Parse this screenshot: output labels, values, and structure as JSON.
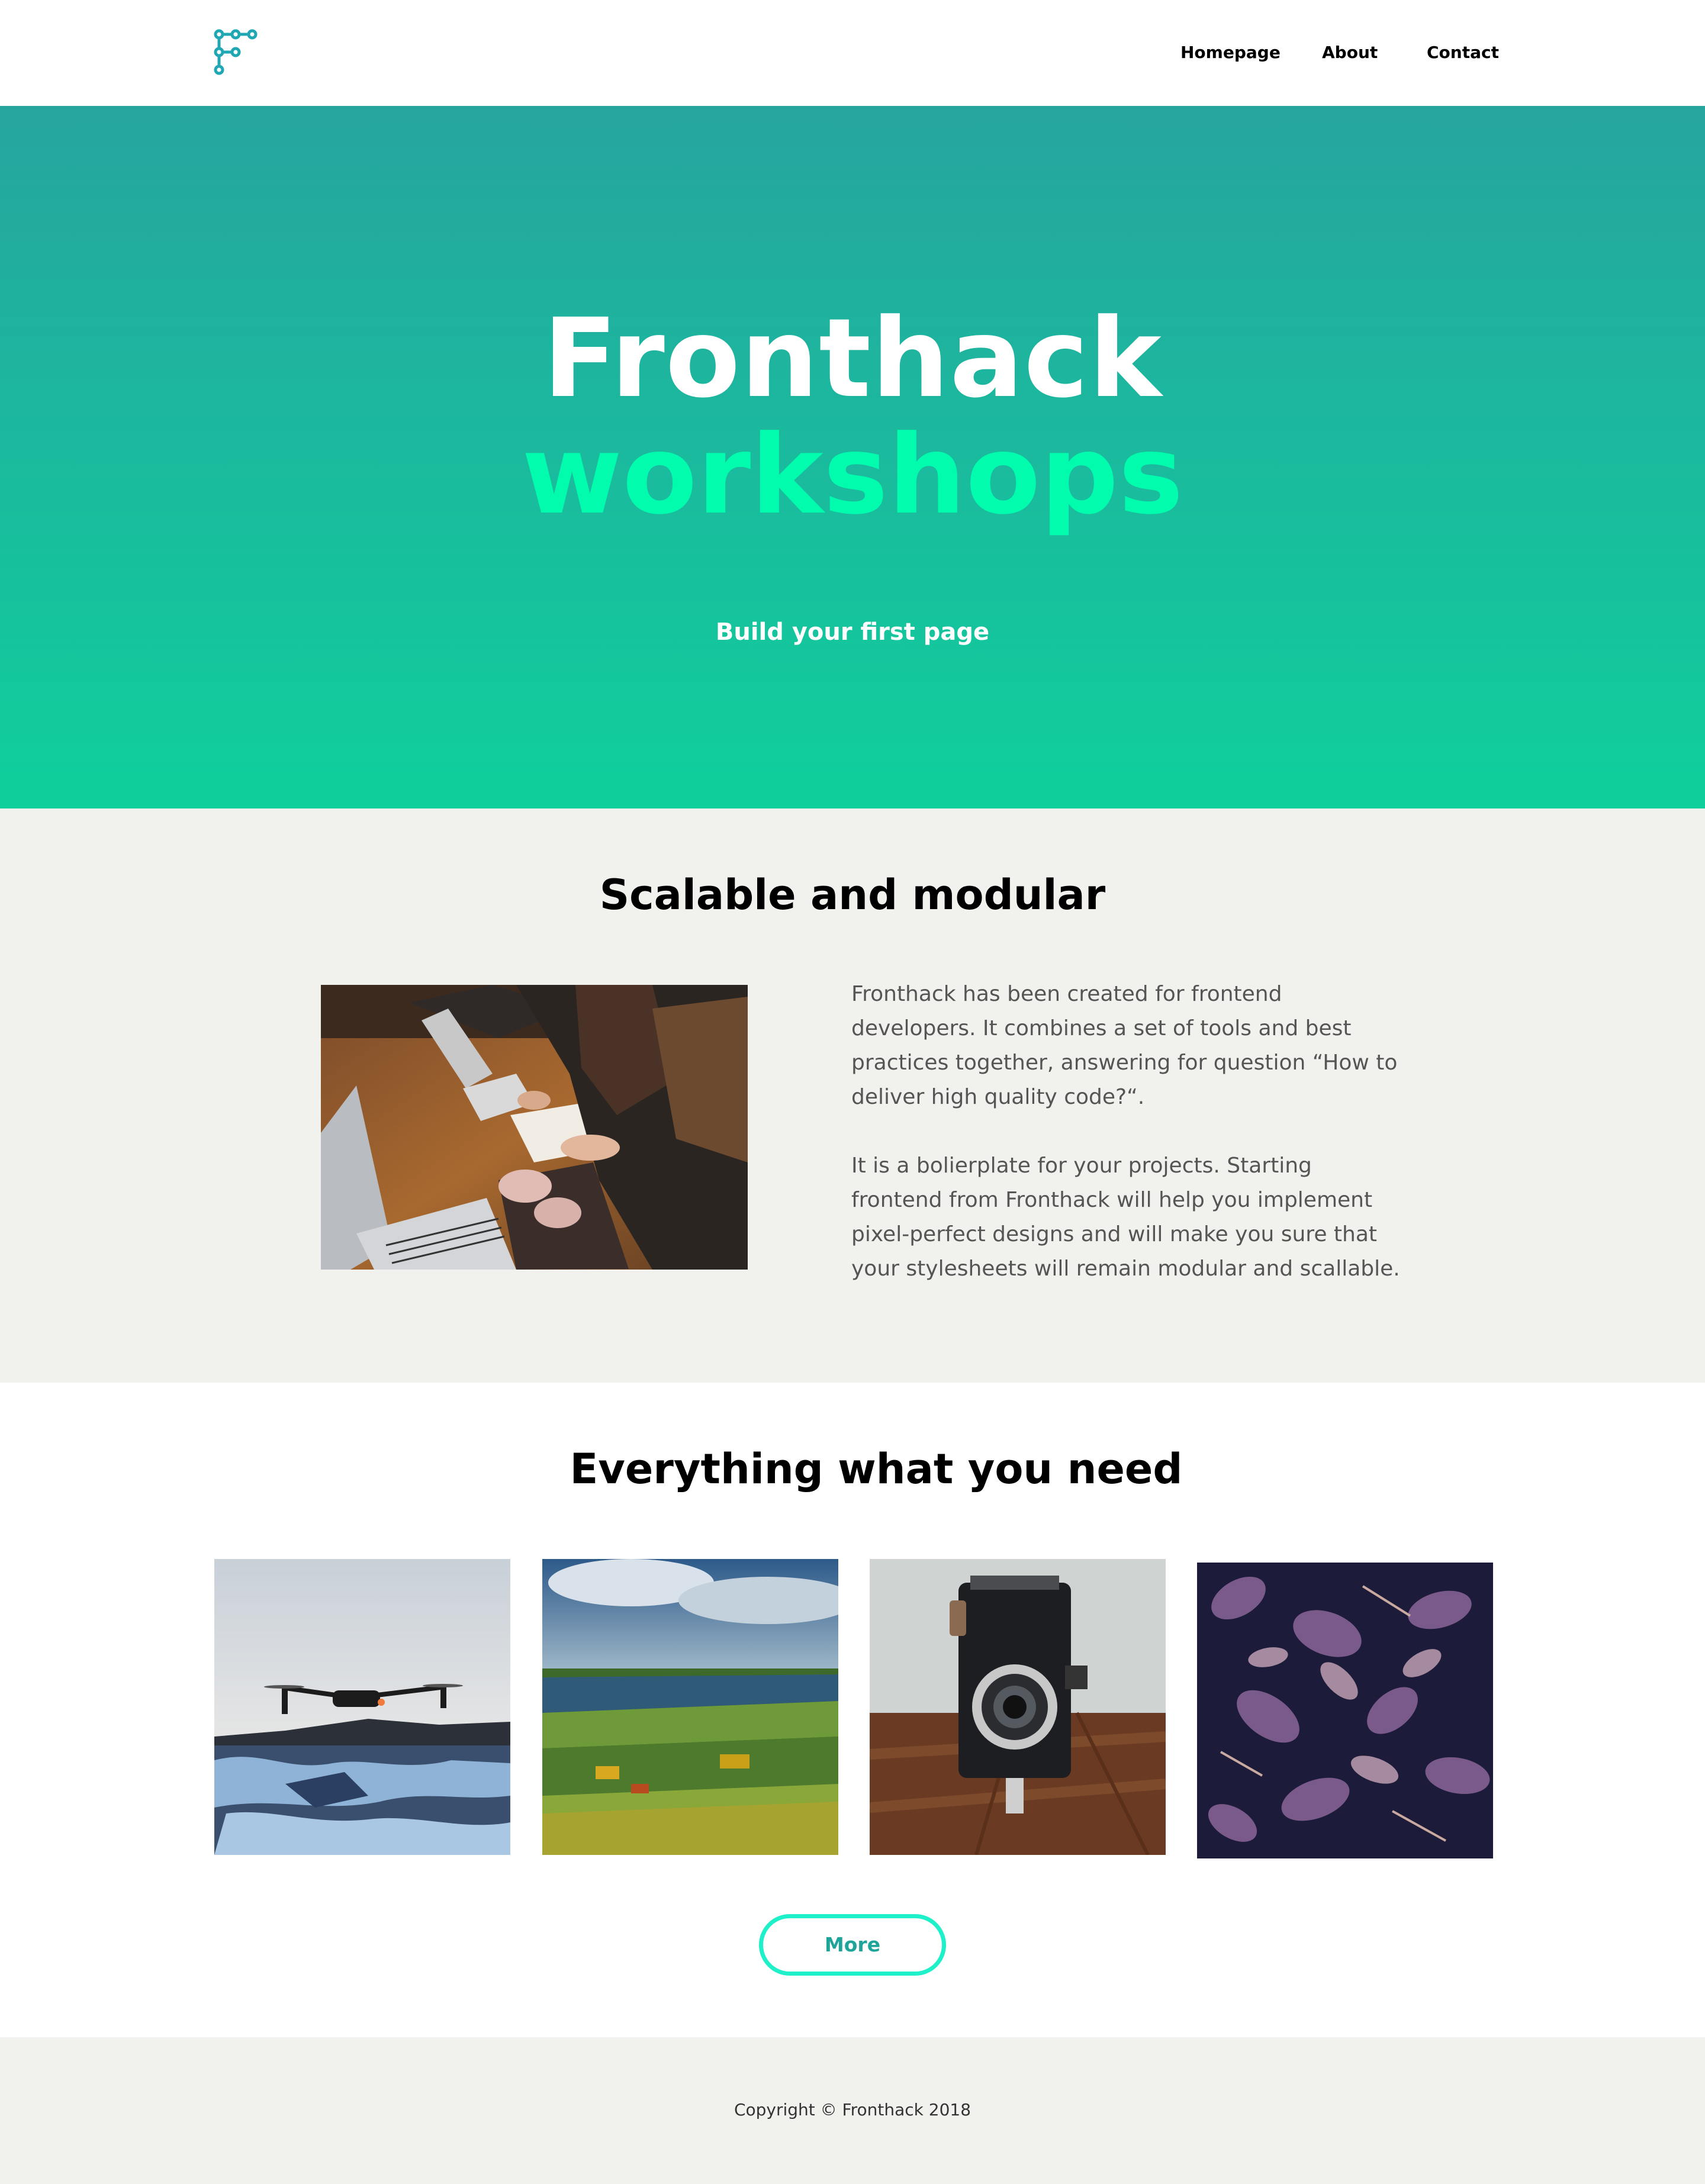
{
  "header": {
    "logo_icon": "fronthack-f-dots-logo-icon",
    "nav": [
      {
        "label": "Homepage"
      },
      {
        "label": "About"
      },
      {
        "label": "Contact"
      }
    ]
  },
  "hero": {
    "title_line1": "Fronthack",
    "title_line2": "workshops",
    "subtitle": "Build your first page",
    "gradient_top": "#26a59f",
    "gradient_bottom": "#0fcf9c",
    "accent_color": "#00fcac"
  },
  "section_modular": {
    "title": "Scalable and modular",
    "image_icon": "people-working-on-laptops-photo",
    "paragraph1": "Fronthack has been created for frontend developers. It combines a set of tools and best practices together, answering for question “How to deliver high quality code?“.",
    "paragraph2": "It is a bolierplate for your projects. Starting frontend from Fronthack will help you implement pixel-perfect designs and will make you sure that your stylesheets will remain modular and scallable."
  },
  "section_everything": {
    "title": "Everything what you need",
    "tiles": [
      {
        "icon": "drone-over-glacier-photo"
      },
      {
        "icon": "green-fields-landscape-photo"
      },
      {
        "icon": "vintage-camera-photo"
      },
      {
        "icon": "purple-plants-photo"
      }
    ],
    "more_label": "More",
    "button_border_color": "#1ef0c9"
  },
  "footer": {
    "copyright": "Copyright © Fronthack 2018"
  }
}
